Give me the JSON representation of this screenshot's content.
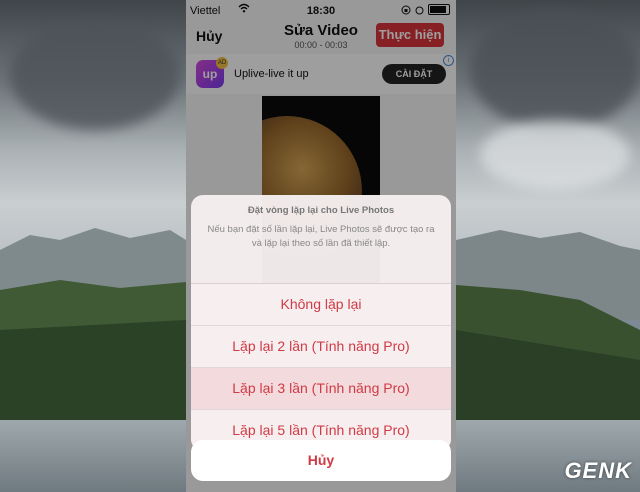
{
  "status": {
    "carrier": "Viettel",
    "time": "18:30"
  },
  "nav": {
    "cancel": "Hủy",
    "title": "Sửa Video",
    "subtitle": "00:00 - 00:03",
    "action": "Thực hiện"
  },
  "ad": {
    "logo": "up",
    "badge": "AD",
    "name": "Uplive-live it up",
    "button": "CÀI ĐẶT",
    "info": "i"
  },
  "sheet": {
    "title": "Đặt vòng lặp lại cho Live Photos",
    "message": "Nếu bạn đặt số lần lặp lại, Live Photos sẽ được tạo ra và lặp lại theo số lần đã thiết lập.",
    "options": [
      "Không lặp lại",
      "Lặp lại 2 lần (Tính năng Pro)",
      "Lặp lại 3 lần (Tính năng Pro)",
      "Lặp lại 5 lần (Tính năng Pro)"
    ],
    "cancel": "Hủy"
  },
  "watermark": "GENK",
  "colors": {
    "accent": "#d9353a",
    "option_text": "#d03a44"
  }
}
